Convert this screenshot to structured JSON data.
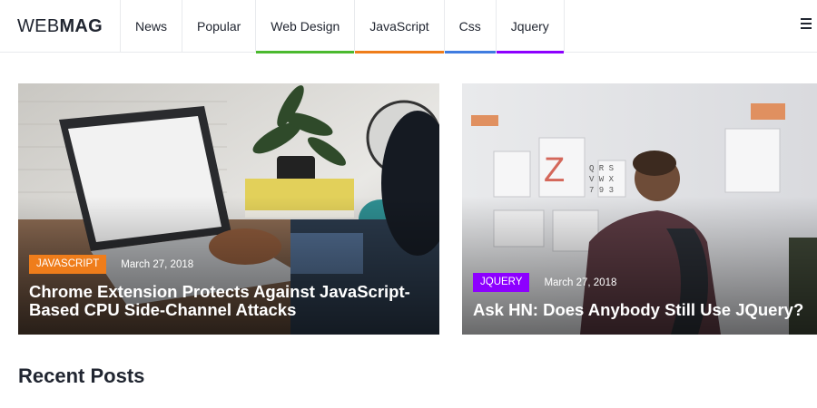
{
  "logo": {
    "light": "WEB",
    "bold": "MAG"
  },
  "nav": [
    {
      "label": "News",
      "color": ""
    },
    {
      "label": "Popular",
      "color": ""
    },
    {
      "label": "Web Design",
      "color": "#4bb92f"
    },
    {
      "label": "JavaScript",
      "color": "#ef7d1b"
    },
    {
      "label": "Css",
      "color": "#3f7ce0"
    },
    {
      "label": "Jquery",
      "color": "#8d00ff"
    }
  ],
  "posts": [
    {
      "category": "JAVASCRIPT",
      "category_color": "#ef7d1b",
      "date": "March 27, 2018",
      "title": "Chrome Extension Protects Against JavaScript-Based CPU Side-Channel Attacks"
    },
    {
      "category": "JQUERY",
      "category_color": "#8d00ff",
      "date": "March 27, 2018",
      "title": "Ask HN: Does Anybody Still Use JQuery?"
    }
  ],
  "recent": {
    "title": "Recent Posts"
  },
  "icons": {
    "menu": "hamburger-menu-icon"
  }
}
